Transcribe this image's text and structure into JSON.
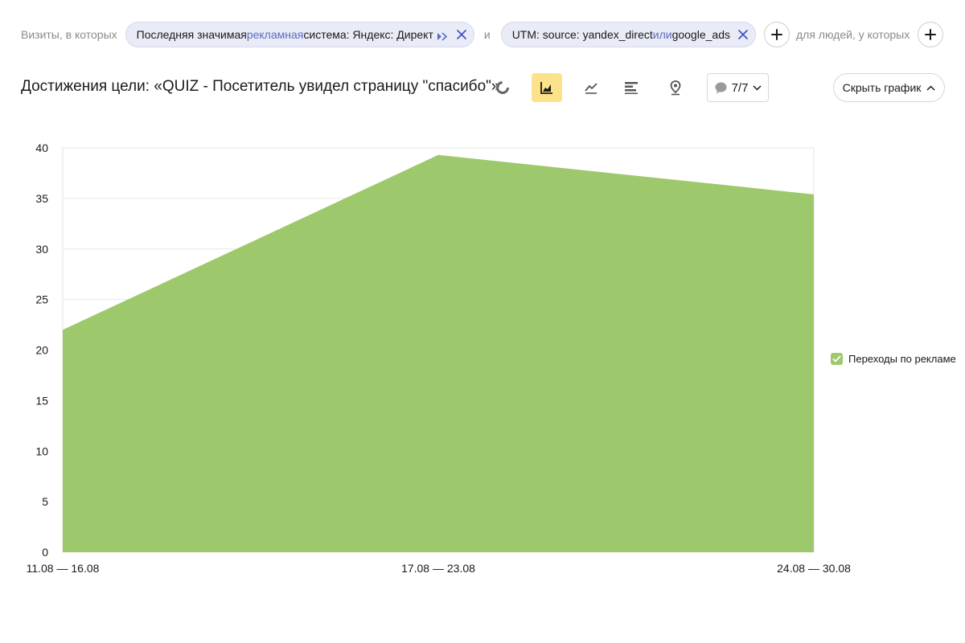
{
  "filters": {
    "prefix": "Визиты, в которых",
    "chip1": {
      "label": "Последняя значимая ",
      "label_mid": "рекламная",
      "label_end": " система: Яндекс: Директ"
    },
    "and_word": "и",
    "chip2": {
      "label": "UTM: source: yandex_direct ",
      "or_word": "или",
      "label_end": " google_ads"
    },
    "people_text": "для людей, у которых"
  },
  "header": {
    "title": "Достижения цели: «QUIZ - Посетитель увидел страницу \"спасибо\"»",
    "notes_count": "7/7",
    "hide_chart_label": "Скрыть график"
  },
  "toolbar": {
    "icons": [
      "pie-chart-icon",
      "area-chart-icon",
      "line-chart-icon",
      "bar-chart-icon",
      "map-pin-icon"
    ],
    "active": "area-chart-icon"
  },
  "colors": {
    "area": "#9dc86b",
    "accent_active": "#fce28a",
    "chip_bg": "#e9ebf7",
    "chip_close": "#3d50c4",
    "legend_check": "#9dc86b"
  },
  "chart_data": {
    "type": "area",
    "categories": [
      "11.08 — 16.08",
      "17.08 — 23.08",
      "24.08 — 30.08"
    ],
    "series": [
      {
        "name": "Переходы по рекламе",
        "values": [
          22,
          39.3,
          35.4
        ]
      }
    ],
    "ylim": [
      0,
      40
    ],
    "yticks": [
      0,
      5,
      10,
      15,
      20,
      25,
      30,
      35,
      40
    ],
    "grid": true,
    "legend": "right"
  }
}
